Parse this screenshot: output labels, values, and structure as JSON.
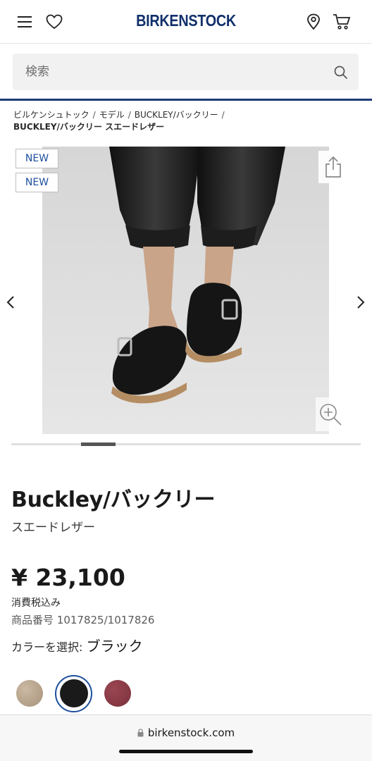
{
  "header": {
    "logo": "BIRKENSTOCK",
    "icons": [
      "menu-icon",
      "heart-icon",
      "location-pin-icon",
      "cart-icon"
    ],
    "brand_color": "#11306b"
  },
  "search": {
    "placeholder": "検索",
    "icon": "search-icon"
  },
  "breadcrumb": {
    "items": [
      "ビルケンシュトック",
      "モデル",
      "BUCKLEY/バックリー"
    ],
    "current": "BUCKLEY/バックリー スエードレザー"
  },
  "gallery": {
    "badges": [
      "NEW",
      "NEW"
    ],
    "badge_color": "#1d4f9c",
    "share_icon": "share-icon",
    "zoom_icon": "zoom-in-icon",
    "prev_icon": "chevron-left-icon",
    "next_icon": "chevron-right-icon",
    "image_alt": "product-photo"
  },
  "product": {
    "title": "Buckley/バックリー",
    "subtitle": "スエードレザー",
    "price": "¥ 23,100",
    "tax_note": "消費税込み",
    "sku_label": "商品番号",
    "sku_value": "1017825/1017826",
    "color_label": "カラーを選択: ",
    "color_value": "ブラック",
    "swatches": [
      {
        "name": "taupe",
        "color": "#b8a590",
        "selected": false
      },
      {
        "name": "black",
        "color": "#1a1a1a",
        "selected": true
      },
      {
        "name": "burgundy",
        "color": "#8a3a45",
        "selected": false
      }
    ]
  },
  "browser": {
    "url": "birkenstock.com",
    "lock_icon": "lock-icon"
  }
}
